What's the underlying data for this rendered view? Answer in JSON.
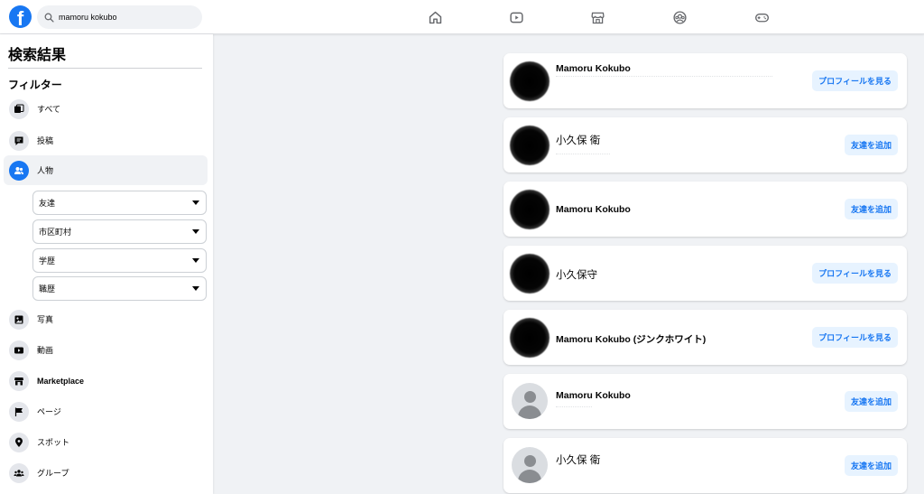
{
  "topbar": {
    "logo": "f",
    "search_value": "mamoru kokubo",
    "nav_icons": [
      "home-icon",
      "watch-icon",
      "marketplace-icon",
      "groups-icon",
      "gaming-icon"
    ]
  },
  "sidebar": {
    "title": "検索結果",
    "filter_heading": "フィルター",
    "items": [
      {
        "label": "すべて",
        "icon": "all-icon"
      },
      {
        "label": "投稿",
        "icon": "posts-icon"
      },
      {
        "label": "人物",
        "icon": "people-icon",
        "active": true
      },
      {
        "label": "写真",
        "icon": "photos-icon"
      },
      {
        "label": "動画",
        "icon": "videos-icon"
      },
      {
        "label": "Marketplace",
        "icon": "marketplace-icon"
      },
      {
        "label": "ページ",
        "icon": "pages-icon"
      },
      {
        "label": "スポット",
        "icon": "places-icon"
      },
      {
        "label": "グループ",
        "icon": "groups-icon"
      }
    ],
    "subfilters": [
      "友達",
      "市区町村",
      "学歴",
      "職歴"
    ]
  },
  "results": [
    {
      "name": "Mamoru Kokubo",
      "action": "プロフィールを見る",
      "avatar": "blurred"
    },
    {
      "name": "小久保 衛",
      "action": "友達を追加",
      "avatar": "blurred"
    },
    {
      "name": "Mamoru Kokubo",
      "action": "友達を追加",
      "avatar": "blurred"
    },
    {
      "name": "小久保守",
      "action": "プロフィールを見る",
      "avatar": "blurred"
    },
    {
      "name": "Mamoru Kokubo (ジンクホワイト)",
      "action": "プロフィールを見る",
      "avatar": "blurred"
    },
    {
      "name": "Mamoru Kokubo",
      "action": "友達を追加",
      "avatar": "default"
    },
    {
      "name": "小久保 衛",
      "action": "友達を追加",
      "avatar": "default"
    }
  ],
  "colors": {
    "brand": "#1877f2",
    "background": "#f0f2f5",
    "action_bg": "#e7f3ff"
  }
}
